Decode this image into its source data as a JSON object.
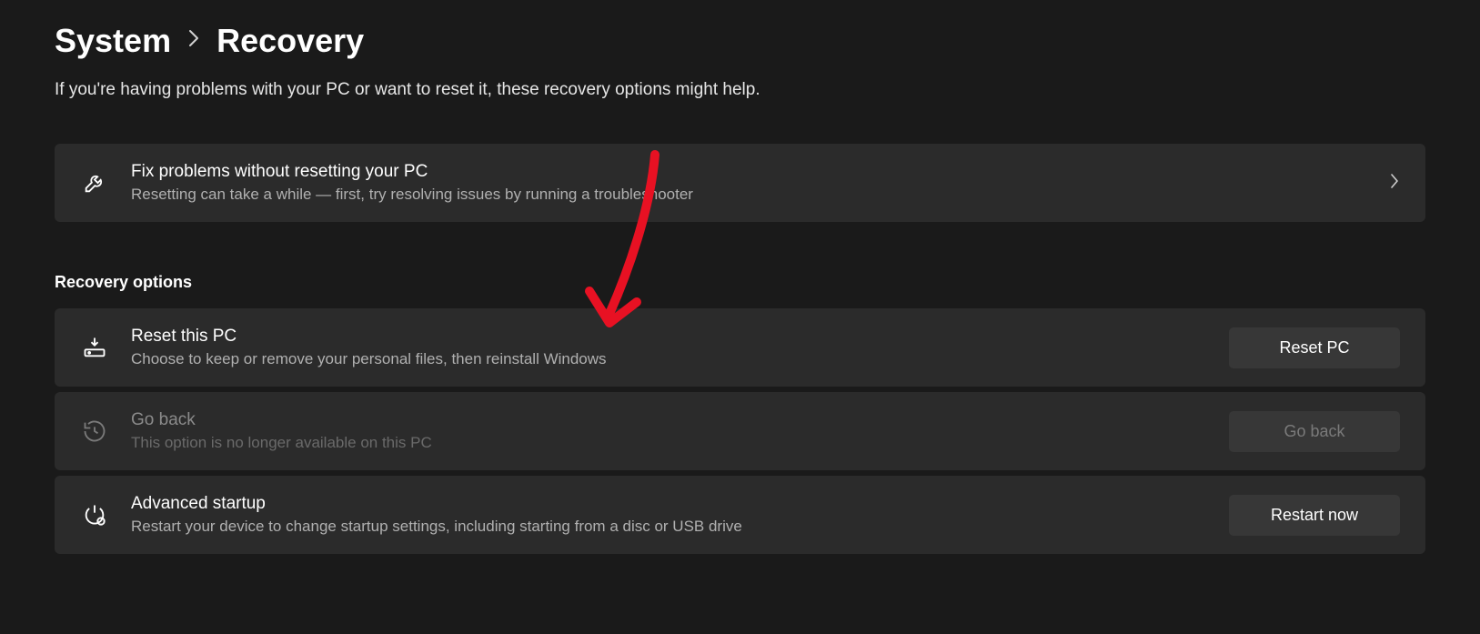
{
  "breadcrumb": {
    "parent": "System",
    "current": "Recovery"
  },
  "intro": "If you're having problems with your PC or want to reset it, these recovery options might help.",
  "fix_card": {
    "title": "Fix problems without resetting your PC",
    "desc": "Resetting can take a while — first, try resolving issues by running a troubleshooter"
  },
  "section_header": "Recovery options",
  "reset": {
    "title": "Reset this PC",
    "desc": "Choose to keep or remove your personal files, then reinstall Windows",
    "button": "Reset PC"
  },
  "goback": {
    "title": "Go back",
    "desc": "This option is no longer available on this PC",
    "button": "Go back"
  },
  "advanced": {
    "title": "Advanced startup",
    "desc": "Restart your device to change startup settings, including starting from a disc or USB drive",
    "button": "Restart now"
  }
}
